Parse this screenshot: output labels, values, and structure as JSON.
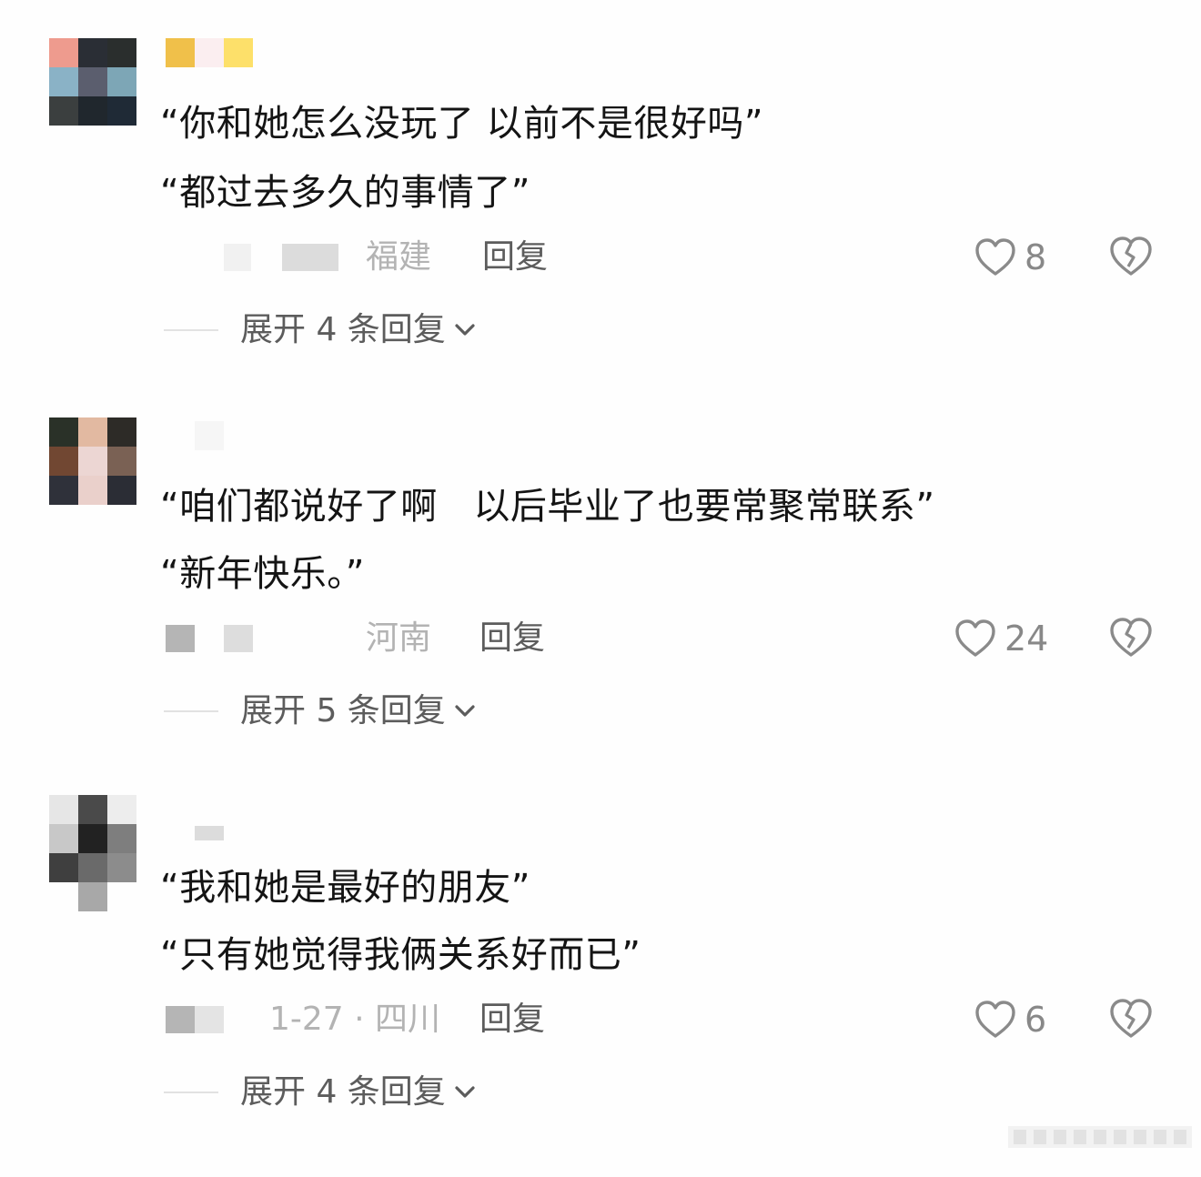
{
  "comments": [
    {
      "avatar_colors": [
        "#ee9b8e",
        "#2a2e35",
        "#2a2e2d",
        "#8ab2c6",
        "#5b5e6e",
        "#7da6b6",
        "#3b3f3f",
        "#20272d",
        "#1f2a36"
      ],
      "avatar_tail": "",
      "lines": [
        "“你和她怎么没玩了 以前不是很好吗”",
        "“都过去多久的事情了”"
      ],
      "location": "福建",
      "reply_label": "回复",
      "likes": "8",
      "expand_label": "展开 4 条回复"
    },
    {
      "avatar_colors": [
        "#2a3128",
        "#e2b9a1",
        "#2d2b27",
        "#714732",
        "#ecd6d3",
        "#7a6154",
        "#2f313a",
        "#ead0cb",
        "#2b2d35"
      ],
      "avatar_tail": "",
      "lines": [
        "“咱们都说好了啊   以后毕业了也要常聚常联系”",
        "“新年快乐。”"
      ],
      "location": "河南",
      "reply_label": "回复",
      "likes": "24",
      "expand_label": "展开 5 条回复"
    },
    {
      "avatar_colors": [
        "#e6e6e6",
        "#4a4a4a",
        "#ededed",
        "#c8c8c8",
        "#222222",
        "#7e7e7e",
        "#3f3f3f",
        "#6a6a6a",
        "#8c8c8c"
      ],
      "avatar_tail": "#a8a8a8",
      "lines": [
        "“我和她是最好的朋友”",
        "“只有她觉得我俩关系好而已”"
      ],
      "location": "1-27 · 四川",
      "reply_label": "回复",
      "likes": "6",
      "expand_label": "展开 4 条回复"
    }
  ]
}
